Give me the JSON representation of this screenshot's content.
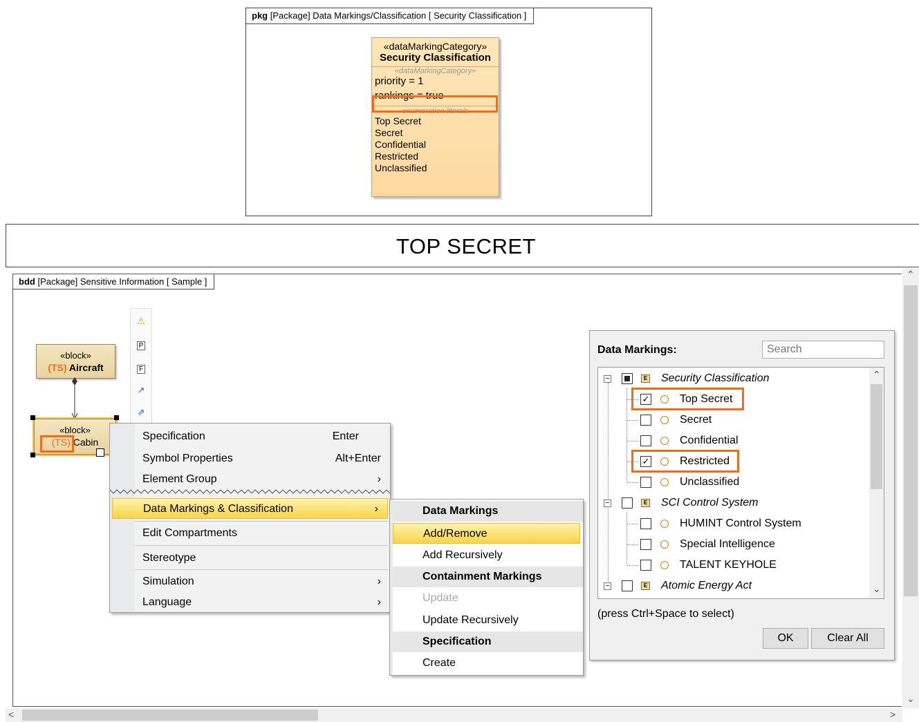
{
  "pkg_frame": {
    "kind": "pkg",
    "title": "[Package] Data Markings/Classification [ Security Classification ]"
  },
  "class_box": {
    "stereotype": "«dataMarkingCategory»",
    "name": "Security Classification",
    "section_label": "«dataMarkingCategory»",
    "properties": [
      "priority = 1",
      "rankings = true"
    ],
    "literals_label": "enumeration literals",
    "literals": [
      "Top Secret",
      "Secret",
      "Confidential",
      "Restricted",
      "Unclassified"
    ]
  },
  "banner": {
    "text": "TOP SECRET"
  },
  "bdd_frame": {
    "kind": "bdd",
    "title": "[Package] Sensitive Information [ Sample ]"
  },
  "blocks": {
    "aircraft": {
      "stereotype": "«block»",
      "marking": "(TS)",
      "name": "Aircraft"
    },
    "cabin": {
      "stereotype": "«block»",
      "marking": "(TS)",
      "name": "Cabin"
    }
  },
  "smart_tools": [
    "warning-icon",
    "port-icon",
    "flow-port-icon",
    "directed-association-icon",
    "generalization-icon"
  ],
  "context_menu": {
    "items": [
      {
        "label": "Specification",
        "shortcut": "Enter"
      },
      {
        "label": "Symbol Properties",
        "shortcut": "Alt+Enter"
      },
      {
        "label": "Element Group",
        "shortcut": "›"
      },
      {
        "label": "Data Markings & Classification",
        "shortcut": "›"
      },
      {
        "label": "Edit Compartments",
        "shortcut": ""
      },
      {
        "label": "Stereotype",
        "shortcut": ""
      },
      {
        "label": "Simulation",
        "shortcut": "›"
      },
      {
        "label": "Language",
        "shortcut": "›"
      }
    ]
  },
  "submenu": {
    "items": [
      {
        "label": "Data Markings",
        "type": "header"
      },
      {
        "label": "Add/Remove",
        "type": "highlighted"
      },
      {
        "label": "Add Recursively",
        "type": "item"
      },
      {
        "label": "Containment Markings",
        "type": "header"
      },
      {
        "label": "Update",
        "type": "disabled"
      },
      {
        "label": "Update Recursively",
        "type": "item"
      },
      {
        "label": "Specification",
        "type": "header"
      },
      {
        "label": "Create",
        "type": "item"
      }
    ]
  },
  "data_markings_dialog": {
    "title": "Data Markings:",
    "search_placeholder": "Search",
    "tree": [
      {
        "label": "Security Classification",
        "type": "category",
        "checked": "partial"
      },
      {
        "label": "Top Secret",
        "type": "literal",
        "checked": true
      },
      {
        "label": "Secret",
        "type": "literal",
        "checked": false
      },
      {
        "label": "Confidential",
        "type": "literal",
        "checked": false
      },
      {
        "label": "Restricted",
        "type": "literal",
        "checked": true
      },
      {
        "label": "Unclassified",
        "type": "literal",
        "checked": false
      },
      {
        "label": "SCI Control System",
        "type": "category",
        "checked": false
      },
      {
        "label": "HUMINT Control System",
        "type": "literal",
        "checked": false
      },
      {
        "label": "Special Intelligence",
        "type": "literal",
        "checked": false
      },
      {
        "label": "TALENT KEYHOLE",
        "type": "literal",
        "checked": false
      },
      {
        "label": "Atomic Energy Act",
        "type": "category",
        "checked": false
      }
    ],
    "hint": "(press Ctrl+Space to select)",
    "ok_label": "OK",
    "clear_label": "Clear All"
  },
  "colors": {
    "highlight_orange": "#ef6c1a",
    "menu_highlight": "#f9d446",
    "class_fill": "#fee6b8",
    "block_fill": "#f5e6c0"
  }
}
